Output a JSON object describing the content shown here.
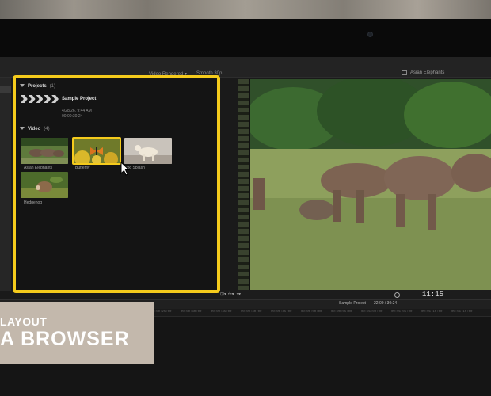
{
  "toolbar": {
    "items": [
      "Video Rendered ▾",
      "Smooth 30p"
    ],
    "viewer_title": "Asian Elephants"
  },
  "browser": {
    "projects": {
      "label": "Projects",
      "count": "(1)"
    },
    "project": {
      "name": "Sample Project",
      "date": "4/28/26, 9:44 AM",
      "duration": "00:00:30:24"
    },
    "video": {
      "label": "Video",
      "count": "(4)"
    },
    "clips": [
      {
        "label": "Asian Elephants"
      },
      {
        "label": "Butterfly"
      },
      {
        "label": "Dog Splash"
      },
      {
        "label": "Hedgehog"
      }
    ]
  },
  "viewer": {
    "timecode": "11:15"
  },
  "timeline": {
    "project": "Sample Project",
    "duration": "22:00 / 30:24",
    "ruler": [
      "00:00:00:00",
      "00:00:05:00",
      "00:00:10:00",
      "00:00:15:00",
      "00:00:20:00",
      "00:00:25:00",
      "00:00:30:00",
      "00:00:35:00",
      "00:00:40:00",
      "00:00:45:00",
      "00:00:50:00",
      "00:00:55:00",
      "00:01:00:00",
      "00:01:05:00",
      "00:01:10:00",
      "00:01:15:00",
      "00:01:20:00"
    ]
  },
  "overlay": {
    "line1": "LAYOUT",
    "line2": "A BROWSER"
  },
  "colors": {
    "highlight": "#f5cb1c",
    "overlay_bg": "#c3b8ac"
  }
}
